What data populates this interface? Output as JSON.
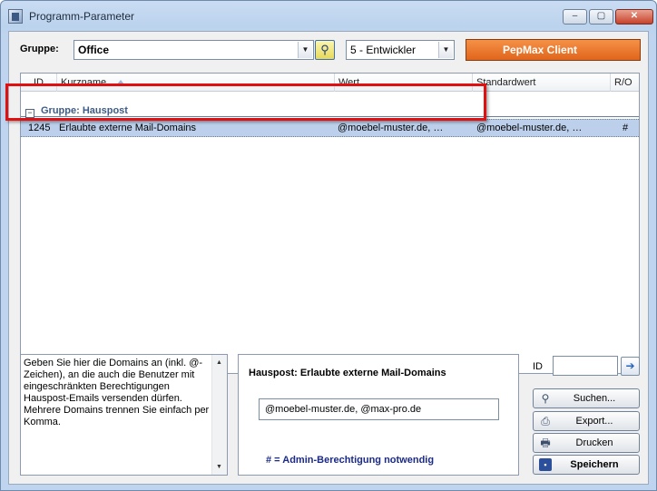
{
  "window": {
    "title": "Programm-Parameter",
    "minimize": "–",
    "maximize": "▢",
    "close": "✕"
  },
  "toolbar": {
    "gruppe_label": "Gruppe:",
    "gruppe_value": "Office",
    "level_value": "5 - Entwickler",
    "client_button": "PepMax Client"
  },
  "grid": {
    "columns": [
      "ID",
      "Kurzname",
      "Wert",
      "Standardwert",
      "R/O"
    ],
    "group_label": "Gruppe: Hauspost",
    "rows": [
      {
        "id": "1245",
        "kurzname": "Erlaubte externe Mail-Domains",
        "wert": "@moebel-muster.de, @max-pro.de",
        "standardwert": "@moebel-muster.de, @max-pro.de",
        "ro": "#"
      }
    ]
  },
  "description": "Geben Sie hier die Domains an (inkl. @-Zeichen), an die auch die Benutzer mit eingeschränkten Berechtigungen Hauspost-Emails versenden dürfen. Mehrere Domains trennen Sie einfach per Komma.",
  "detail": {
    "title": "Hauspost: Erlaubte externe Mail-Domains",
    "value": "@moebel-muster.de, @max-pro.de",
    "note": "# = Admin-Berechtigung notwendig"
  },
  "side": {
    "id_label": "ID",
    "buttons": {
      "suchen": "Suchen...",
      "export": "Export...",
      "drucken": "Drucken",
      "speichern": "Speichern"
    }
  }
}
